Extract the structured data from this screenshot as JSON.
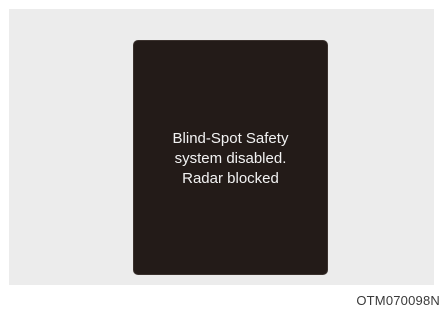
{
  "display": {
    "message": "Blind-Spot Safety\nsystem disabled.\nRadar blocked"
  },
  "figure": {
    "code": "OTM070098N"
  }
}
